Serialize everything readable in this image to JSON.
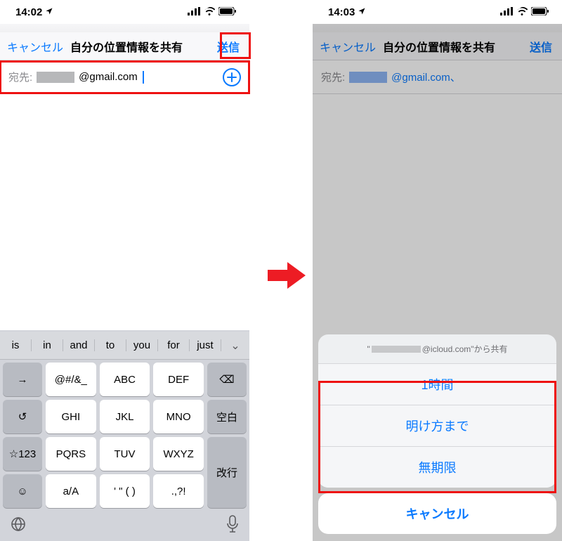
{
  "left": {
    "status": {
      "time": "14:02"
    },
    "nav": {
      "cancel": "キャンセル",
      "title": "自分の位置情報を共有",
      "send": "送信"
    },
    "recipient": {
      "label": "宛先:",
      "email_suffix": "@gmail.com"
    },
    "keyboard": {
      "suggestions": [
        "is",
        "in",
        "and",
        "to",
        "you",
        "for",
        "just"
      ],
      "rows": {
        "r1": [
          "@#/&_",
          "ABC",
          "DEF"
        ],
        "r2": [
          "GHI",
          "JKL",
          "MNO"
        ],
        "r3": [
          "PQRS",
          "TUV",
          "WXYZ"
        ],
        "r4": [
          "a/A",
          "' \" ( )",
          ".,?!"
        ]
      },
      "func": {
        "arrow": "→",
        "undo": "↺",
        "star": "☆123",
        "emoji": "☺",
        "del": "⌫",
        "space": "空白",
        "enter": "改行"
      }
    }
  },
  "right": {
    "status": {
      "time": "14:03"
    },
    "nav": {
      "cancel": "キャンセル",
      "title": "自分の位置情報を共有",
      "send": "送信"
    },
    "recipient": {
      "label": "宛先:",
      "email_suffix": "@gmail.com、"
    },
    "sheet": {
      "header_prefix": "\"",
      "header_suffix": "@icloud.com\"から共有",
      "items": [
        "1時間",
        "明け方まで",
        "無期限"
      ],
      "cancel": "キャンセル"
    }
  }
}
